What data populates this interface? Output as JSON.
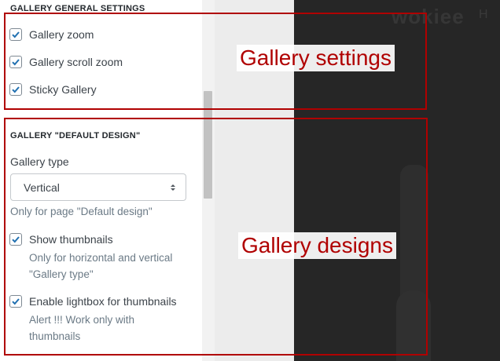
{
  "general_settings": {
    "title": "GALLERY GENERAL SETTINGS",
    "options": [
      {
        "label": "Gallery zoom",
        "checked": true
      },
      {
        "label": "Gallery scroll zoom",
        "checked": true
      },
      {
        "label": "Sticky Gallery",
        "checked": true
      }
    ]
  },
  "default_design": {
    "title": "GALLERY \"DEFAULT DESIGN\"",
    "gallery_type_label": "Gallery type",
    "gallery_type_value": "Vertical",
    "gallery_type_help": "Only for page \"Default design\"",
    "show_thumbnails_label": "Show thumbnails",
    "show_thumbnails_checked": true,
    "show_thumbnails_help_1": "Only for horizontal and vertical",
    "show_thumbnails_help_2": "\"Gallery type\"",
    "lightbox_label": "Enable lightbox for thumbnails",
    "lightbox_checked": true,
    "lightbox_help_1": "Alert !!! Work only with",
    "lightbox_help_2": "thumbnails"
  },
  "preview": {
    "logo": "wokiee",
    "nav_item": "H"
  },
  "annotations": {
    "settings_label": "Gallery settings",
    "designs_label": "Gallery designs",
    "color": "#b00000"
  },
  "colors": {
    "checkbox_check": "#2271b1",
    "help_text": "#6b7a86"
  }
}
